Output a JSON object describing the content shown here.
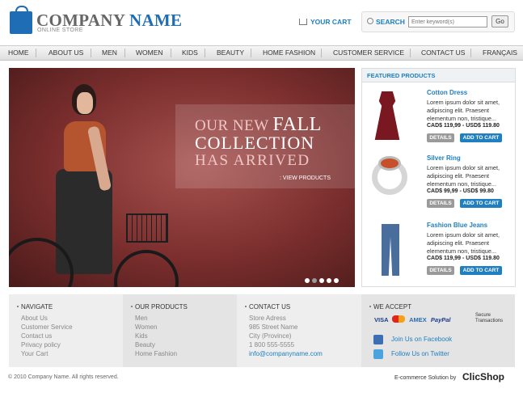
{
  "header": {
    "logo_word1": "COMPANY",
    "logo_word2": "NAME",
    "logo_sub": "ONLINE STORE",
    "cart_label": "YOUR CART",
    "search_label": "SEARCH",
    "search_placeholder": "Enter keyword(s)",
    "go_label": "Go"
  },
  "nav": [
    "HOME",
    "ABOUT US",
    "MEN",
    "WOMEN",
    "KIDS",
    "BEAUTY",
    "HOME FASHION",
    "CUSTOMER SERVICE",
    "CONTACT US",
    "FRANÇAIS"
  ],
  "hero": {
    "line1a": "OUR NEW",
    "line1b": "FALL",
    "line2": "COLLECTION",
    "line3": "HAS ARRIVED",
    "cta": ": VIEW PRODUCTS",
    "slide_count": 5,
    "active_slide": 1
  },
  "featured": {
    "title": "FEATURED PRODUCTS",
    "details_label": "DETAILS",
    "cart_label": "ADD TO CART",
    "products": [
      {
        "name": "Cotton Dress",
        "desc": "Lorem ipsum dolor sit amet, adipiscing elit. Praesent elementum non, tristique...",
        "price": "CAD$ 119,99 - USD$ 119.80"
      },
      {
        "name": "Silver Ring",
        "desc": "Lorem ipsum dolor sit amet, adipiscing elit. Praesent elementum non, tristique...",
        "price": "CAD$ 99,99 - USD$ 99.80"
      },
      {
        "name": "Fashion Blue Jeans",
        "desc": "Lorem ipsum dolor sit amet, adipiscing elit. Praesent elementum non, tristique...",
        "price": "CAD$ 119,99 - USD$ 119.80"
      }
    ]
  },
  "footer": {
    "navigate": {
      "title": "NAVIGATE",
      "links": [
        "About Us",
        "Customer Service",
        "Contact us",
        "Privacy policy",
        "Your Cart"
      ]
    },
    "products": {
      "title": "OUR PRODUCTS",
      "links": [
        "Men",
        "Women",
        "Kids",
        "Beauty",
        "Home Fashion"
      ]
    },
    "contact": {
      "title": "CONTACT US",
      "lines": [
        "Store Adress",
        "985 Street Name",
        "City (Province)",
        "1 800 555-5555"
      ],
      "email": "info@companyname.com"
    },
    "accept": {
      "title": "WE ACCEPT",
      "cards": [
        "VISA",
        "MasterCard",
        "AMEX",
        "PayPal"
      ],
      "secure": "Secure Transactions",
      "facebook": "Join Us on Facebook",
      "twitter": "Follow Us on Twitter"
    },
    "copyright": "© 2010 Company Name. All rights reserved.",
    "solution": "E-commerce Solution by",
    "brand": "ClicShop"
  }
}
